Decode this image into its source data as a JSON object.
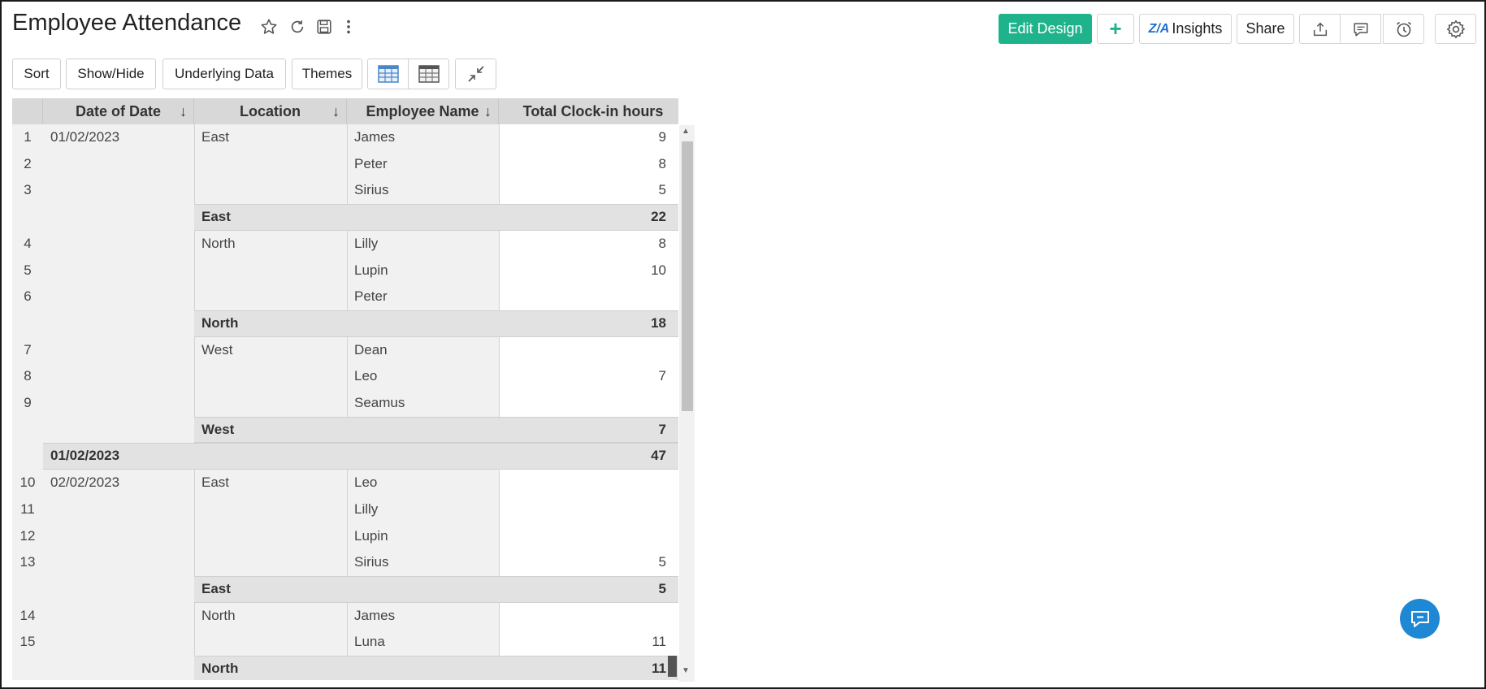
{
  "header": {
    "title": "Employee Attendance",
    "title_icons": [
      "star-icon",
      "refresh-icon",
      "save-icon",
      "more-vertical-icon"
    ],
    "edit_design_label": "Edit Design",
    "add_label": "+",
    "insights_label": "Insights",
    "share_label": "Share",
    "right_icons": [
      "export-icon",
      "comment-icon",
      "alarm-icon",
      "gear-icon"
    ],
    "accent_color": "#1fb38c"
  },
  "toolbar": {
    "sort_label": "Sort",
    "show_hide_label": "Show/Hide",
    "underlying_data_label": "Underlying Data",
    "themes_label": "Themes",
    "view_icons": [
      "table-view-icon",
      "pivot-view-icon",
      "collapse-icon"
    ]
  },
  "table": {
    "columns": [
      {
        "label": "Date of Date",
        "sort": "↓"
      },
      {
        "label": "Location",
        "sort": "↓"
      },
      {
        "label": "Employee Name",
        "sort": "↓"
      },
      {
        "label": "Total Clock-in hours",
        "sort": ""
      }
    ],
    "rows": [
      {
        "n": "1",
        "date": "01/02/2023",
        "loc": "East",
        "name": "James",
        "hours": "9"
      },
      {
        "n": "2",
        "date": "",
        "loc": "",
        "name": "Peter",
        "hours": "8"
      },
      {
        "n": "3",
        "date": "",
        "loc": "",
        "name": "Sirius",
        "hours": "5"
      },
      {
        "type": "loc_total",
        "loc": "East",
        "hours": "22"
      },
      {
        "n": "4",
        "date": "",
        "loc": "North",
        "name": "Lilly",
        "hours": "8"
      },
      {
        "n": "5",
        "date": "",
        "loc": "",
        "name": "Lupin",
        "hours": "10"
      },
      {
        "n": "6",
        "date": "",
        "loc": "",
        "name": "Peter",
        "hours": ""
      },
      {
        "type": "loc_total",
        "loc": "North",
        "hours": "18"
      },
      {
        "n": "7",
        "date": "",
        "loc": "West",
        "name": "Dean",
        "hours": ""
      },
      {
        "n": "8",
        "date": "",
        "loc": "",
        "name": "Leo",
        "hours": "7"
      },
      {
        "n": "9",
        "date": "",
        "loc": "",
        "name": "Seamus",
        "hours": ""
      },
      {
        "type": "loc_total",
        "loc": "West",
        "hours": "7"
      },
      {
        "type": "date_total",
        "date": "01/02/2023",
        "hours": "47"
      },
      {
        "n": "10",
        "date": "02/02/2023",
        "loc": "East",
        "name": "Leo",
        "hours": ""
      },
      {
        "n": "11",
        "date": "",
        "loc": "",
        "name": "Lilly",
        "hours": ""
      },
      {
        "n": "12",
        "date": "",
        "loc": "",
        "name": "Lupin",
        "hours": ""
      },
      {
        "n": "13",
        "date": "",
        "loc": "",
        "name": "Sirius",
        "hours": "5"
      },
      {
        "type": "loc_total",
        "loc": "East",
        "hours": "5"
      },
      {
        "n": "14",
        "date": "",
        "loc": "North",
        "name": "James",
        "hours": ""
      },
      {
        "n": "15",
        "date": "",
        "loc": "",
        "name": "Luna",
        "hours": "11"
      },
      {
        "type": "loc_total",
        "loc": "North",
        "hours": "11"
      }
    ]
  },
  "chat": {
    "icon": "chat-icon",
    "color": "#1e88d4"
  }
}
